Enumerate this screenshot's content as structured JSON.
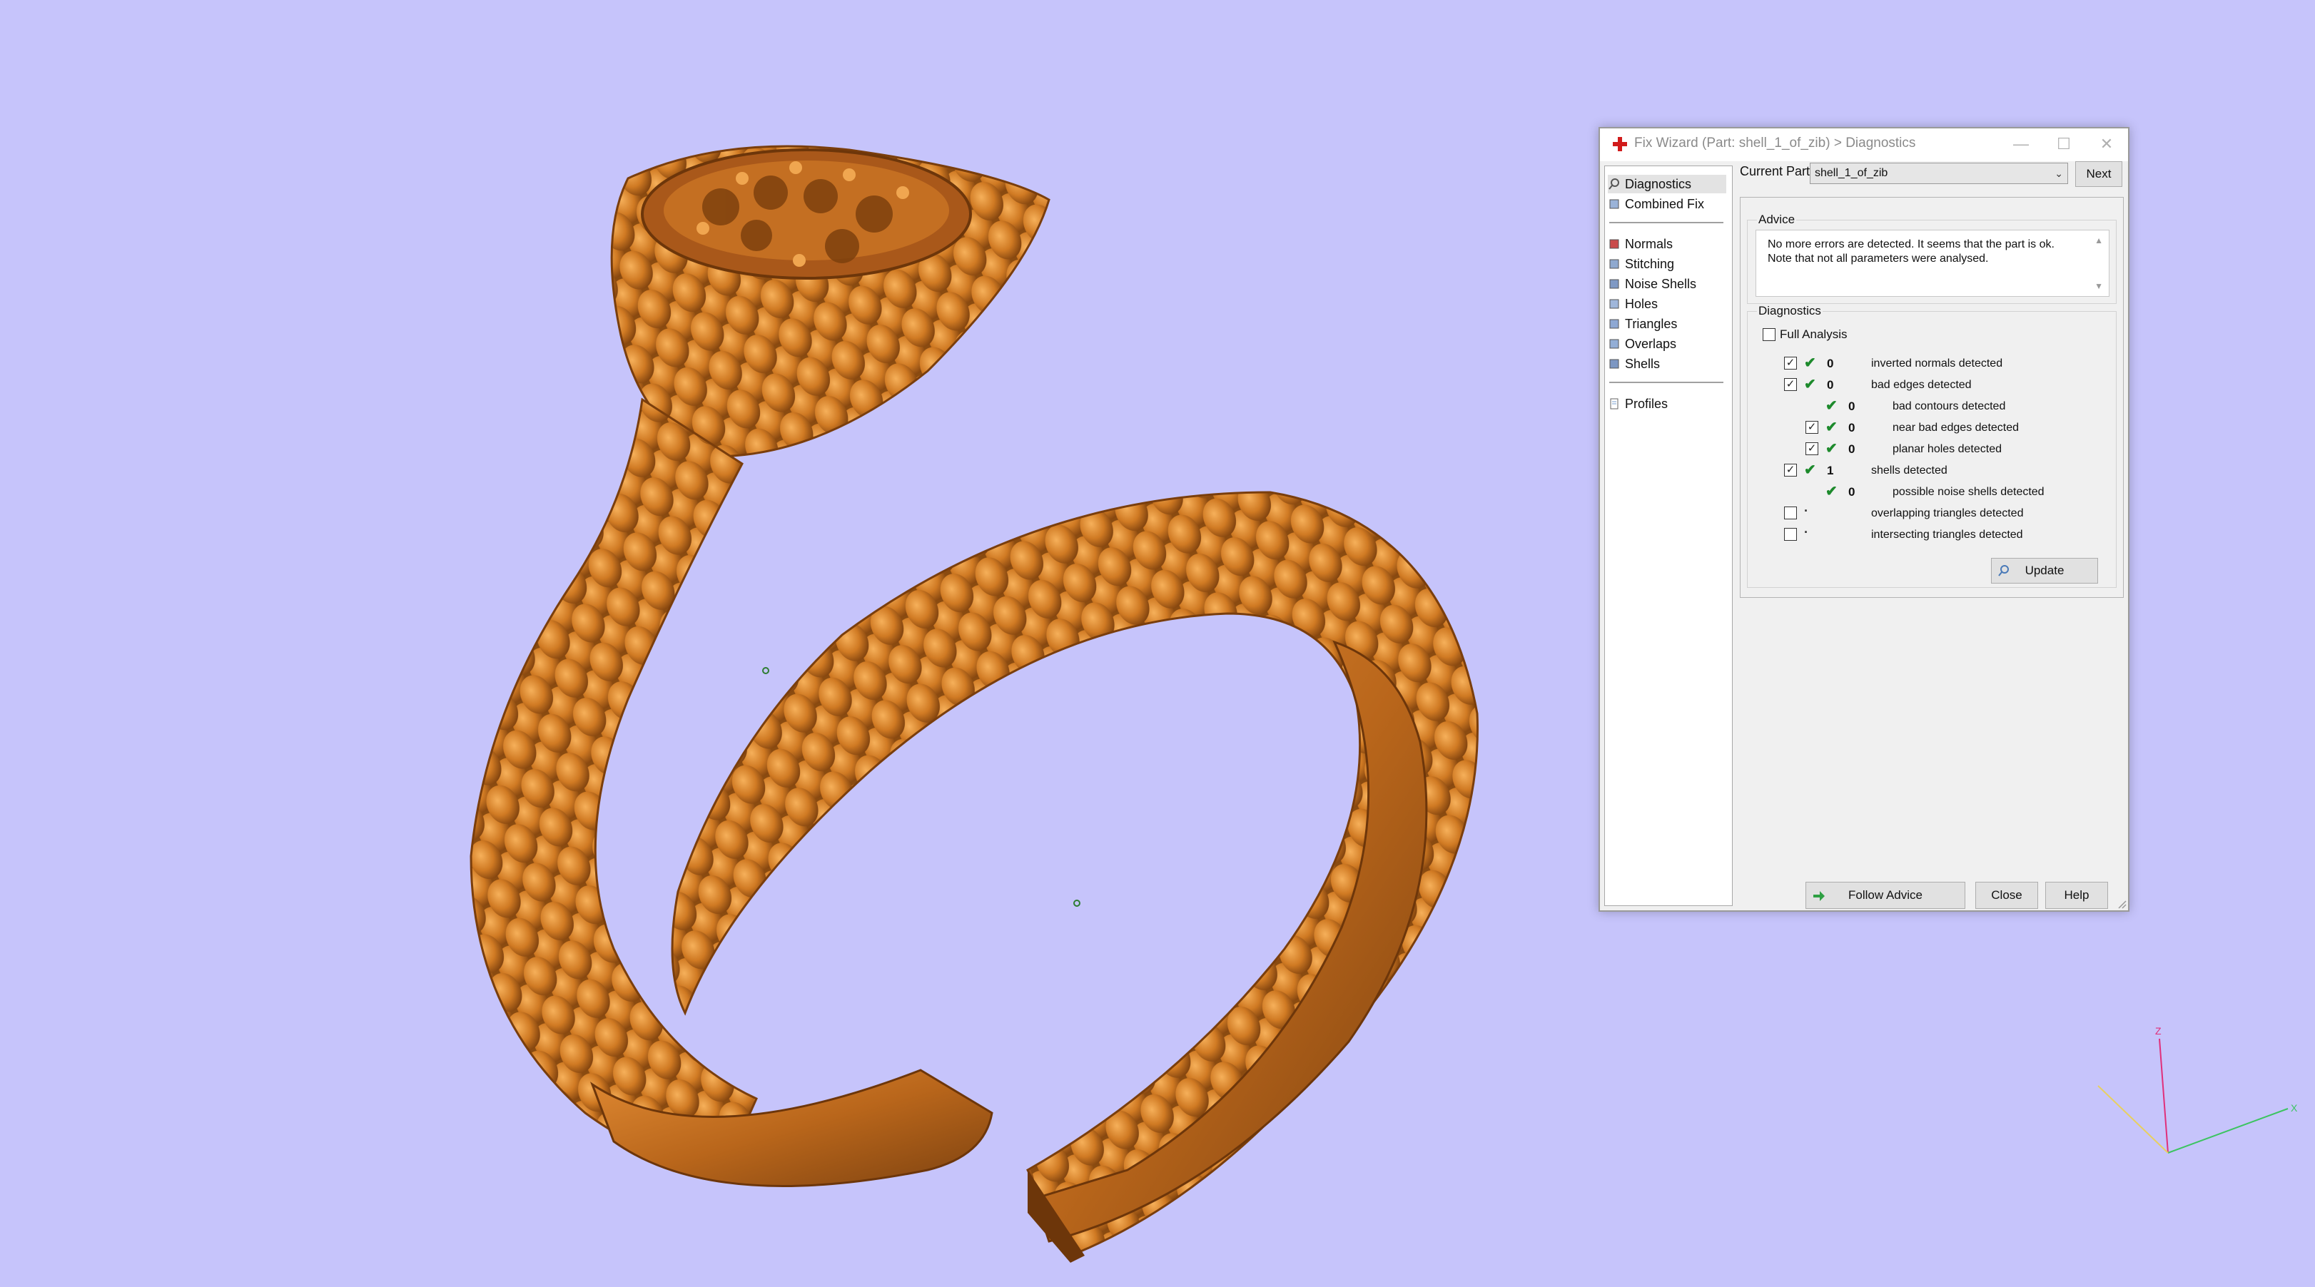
{
  "window": {
    "title": "Fix Wizard (Part: shell_1_of_zib) > Diagnostics",
    "controls": {
      "minimize": "—",
      "maximize": "☐",
      "close": "✕"
    }
  },
  "sidebar": {
    "top_items": [
      {
        "label": "Diagnostics",
        "icon": "magnifier-icon",
        "selected": true
      },
      {
        "label": "Combined Fix",
        "icon": "cube-icon"
      }
    ],
    "tool_items": [
      {
        "label": "Normals",
        "icon": "normals-icon"
      },
      {
        "label": "Stitching",
        "icon": "stitching-icon"
      },
      {
        "label": "Noise Shells",
        "icon": "noise-shells-icon"
      },
      {
        "label": "Holes",
        "icon": "holes-icon"
      },
      {
        "label": "Triangles",
        "icon": "triangles-icon"
      },
      {
        "label": "Overlaps",
        "icon": "overlaps-icon"
      },
      {
        "label": "Shells",
        "icon": "shells-icon"
      }
    ],
    "bottom_items": [
      {
        "label": "Profiles",
        "icon": "document-icon"
      }
    ]
  },
  "current_part": {
    "label": "Current Part:",
    "value": "shell_1_of_zib"
  },
  "buttons": {
    "next": "Next",
    "update": "Update",
    "follow_advice": "Follow Advice",
    "close": "Close",
    "help": "Help"
  },
  "advice": {
    "title": "Advice",
    "text": "No more errors are detected. It seems that the part is ok. Note that not all parameters were analysed."
  },
  "diagnostics": {
    "title": "Diagnostics",
    "full_analysis_label": "Full Analysis",
    "full_analysis_checked": false,
    "rows": [
      {
        "checkbox": true,
        "checked": true,
        "status": "ok",
        "count": "0",
        "label": "inverted normals detected",
        "indent": 0
      },
      {
        "checkbox": true,
        "checked": true,
        "status": "ok",
        "count": "0",
        "label": "bad edges detected",
        "indent": 0
      },
      {
        "checkbox": false,
        "checked": false,
        "status": "ok",
        "count": "0",
        "label": "bad contours detected",
        "indent": 1
      },
      {
        "checkbox": true,
        "checked": true,
        "status": "ok",
        "count": "0",
        "label": "near bad edges detected",
        "indent": 1
      },
      {
        "checkbox": true,
        "checked": true,
        "status": "ok",
        "count": "0",
        "label": "planar holes detected",
        "indent": 1
      },
      {
        "checkbox": true,
        "checked": true,
        "status": "ok",
        "count": "1",
        "label": "shells detected",
        "indent": 0
      },
      {
        "checkbox": false,
        "checked": false,
        "status": "ok",
        "count": "0",
        "label": "possible noise shells detected",
        "indent": 1
      },
      {
        "checkbox": true,
        "checked": false,
        "status": "unknown",
        "count": "",
        "label": "overlapping triangles detected",
        "indent": 0
      },
      {
        "checkbox": true,
        "checked": false,
        "status": "unknown",
        "count": "",
        "label": "intersecting triangles detected",
        "indent": 0
      }
    ]
  },
  "axes": {
    "z_label": "Z",
    "x_label": "X"
  },
  "colors": {
    "background": "#c6c4fb",
    "ring_main": "#d07a23",
    "ring_dark": "#8a4b10",
    "ring_light": "#f0a650",
    "ok_tick": "#1d8a2c"
  }
}
